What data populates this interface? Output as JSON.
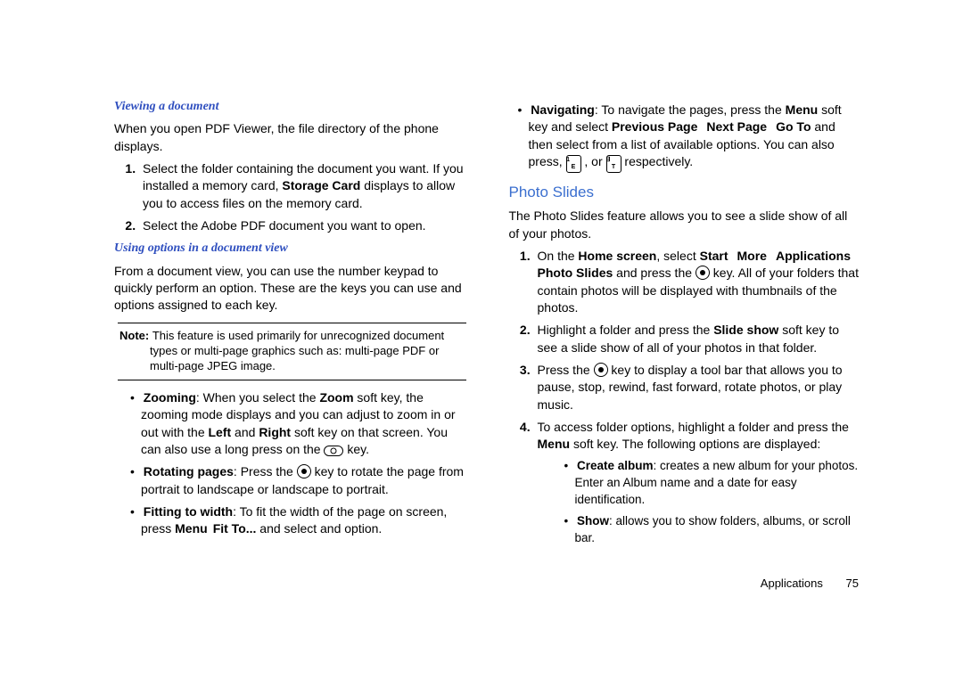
{
  "left": {
    "h1": "Viewing a document",
    "p1": "When you open PDF Viewer, the file directory of the phone displays.",
    "ol1_1_a": "Select the folder containing the document you want. If you installed a memory card, ",
    "ol1_1_b": "Storage Card",
    "ol1_1_c": " displays to allow you to access files on the memory card.",
    "ol1_2": "Select the Adobe PDF document you want to open.",
    "h2": "Using options in a document view",
    "p2": "From a document view, you can use the number keypad to quickly perform an option. These are the keys you can use and options assigned to each key.",
    "note_label": "Note: ",
    "note_text": "This feature is used primarily for unrecognized document types or multi-page graphics such as: multi-page PDF or multi-page JPEG image.",
    "zoom_label": "Zooming",
    "zoom_a": ": When you select the ",
    "zoom_b": "Zoom",
    "zoom_c": " soft key, the zooming mode displays and you can adjust to zoom in or out with the ",
    "zoom_d": "Left",
    "zoom_e": " and ",
    "zoom_f": "Right",
    "zoom_g": " soft key on that screen. You can also use a long press on the ",
    "zoom_h": " key.",
    "rot_label": "Rotating pages",
    "rot_a": ": Press the ",
    "rot_b": " key to ",
    "rot_c": "rotate the page from portrait to landscape or landscape to portrait.",
    "fit_label": "Fitting to width",
    "fit_a": ": To fit the width of the page on screen, press ",
    "fit_b": "Menu",
    "fit_c": " ",
    "fit_d": "Fit To...",
    "fit_e": " and select and option."
  },
  "right": {
    "nav_label": "Navigating",
    "nav_a": ": To navigate the pages, press the ",
    "nav_b": "Menu",
    "nav_c": " soft key and select ",
    "nav_d": "Previous Page",
    "nav_e": "Next Page",
    "nav_f": "Go To",
    "nav_g": " and then select from a list of available options. You can also press, ",
    "nav_h": " , or ",
    "nav_i": " respectively.",
    "key1_top": "1",
    "key1_bot": "E",
    "key2_top": "∃",
    "key2_bot": "T",
    "title": "Photo Slides",
    "p1": "The Photo Slides feature allows you to see a slide show of all of your photos.",
    "s1_a": "On the ",
    "s1_b": "Home screen",
    "s1_c": ", select ",
    "s1_d": "Start",
    "s1_e": "More",
    "s1_f": "Applications",
    "s1_g": "Photo Slides",
    "s1_h": " and press the ",
    "s1_i": " key. All of your folders that contain photos will be displayed with thumbnails of the photos.",
    "s2_a": "Highlight a folder and press the ",
    "s2_b": "Slide show",
    "s2_c": " soft key to see a slide show of all of your photos in that folder.",
    "s3_a": "Press the ",
    "s3_b": " key to display a tool bar that allows you to pause, stop, rewind, fast forward, rotate photos, or play music.",
    "s4_a": "To access folder options, highlight a folder and press the ",
    "s4_b": "Menu",
    "s4_c": " soft key. The following options are displayed:",
    "ca_label": "Create album",
    "ca_text": ": creates a new album for your photos. Enter an Album name and a date for easy identification.",
    "show_label": "Show",
    "show_text": ": allows you to show folders, albums, or scroll bar.",
    "footer_chapter": "Applications",
    "footer_page": "75"
  }
}
